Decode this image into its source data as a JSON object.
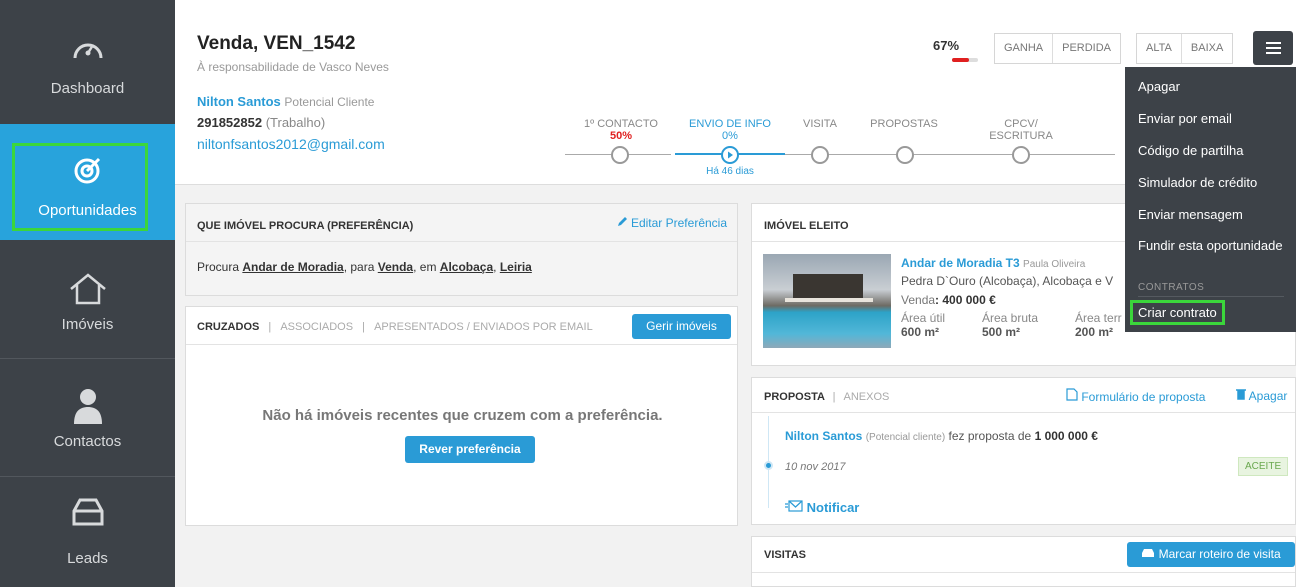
{
  "sidebar": {
    "items": [
      {
        "label": "Dashboard",
        "icon": "speedometer-icon"
      },
      {
        "label": "Oportunidades",
        "icon": "target-icon"
      },
      {
        "label": "Imóveis",
        "icon": "house-icon"
      },
      {
        "label": "Contactos",
        "icon": "person-icon"
      },
      {
        "label": "Leads",
        "icon": "inbox-icon"
      }
    ]
  },
  "header": {
    "title": "Venda, VEN_1542",
    "subtitle": "À responsabilidade de Vasco Neves",
    "client_name": "Nilton Santos",
    "client_status": "Potencial Cliente",
    "phone": "291852852",
    "phone_type": "(Trabalho)",
    "email": "niltonfsantos2012@gmail.com",
    "probability": "67%",
    "probability_value": 0.67,
    "btn_ganha": "GANHA",
    "btn_perdida": "PERDIDA",
    "btn_alta": "ALTA",
    "btn_baixa": "BAIXA"
  },
  "stages": [
    {
      "label": "1º CONTACTO",
      "pct": "50%"
    },
    {
      "label": "ENVIO DE INFO",
      "pct": "0%"
    },
    {
      "label": "VISITA",
      "pct": ""
    },
    {
      "label": "PROPOSTAS",
      "pct": ""
    },
    {
      "label": "CPCV/ ESCRITURA",
      "pct": ""
    }
  ],
  "stage_note": "Há 46 dias",
  "menu": {
    "items": [
      "Apagar",
      "Enviar por email",
      "Código de partilha",
      "Simulador de crédito",
      "Enviar mensagem",
      "Fundir esta oportunidade"
    ],
    "section": "CONTRATOS",
    "contract_item": "Criar contrato"
  },
  "preference": {
    "title": "QUE IMÓVEL PROCURA (PREFERÊNCIA)",
    "edit": "Editar Preferência",
    "text_1": "Procura ",
    "type": "Andar de Moradia",
    "text_2": ", para ",
    "deal": "Venda",
    "text_3": ", em ",
    "place1": "Alcobaça",
    "text_4": ", ",
    "place2": "Leiria"
  },
  "cross": {
    "tab_1": "CRUZADOS",
    "tab_2": "ASSOCIADOS",
    "tab_3": "APRESENTADOS / ENVIADOS POR EMAIL",
    "manage": "Gerir imóveis",
    "empty": "Não há imóveis recentes que cruzem com a preferência.",
    "review": "Rever preferência"
  },
  "elected": {
    "title": "IMÓVEL ELEITO",
    "name": "Andar de Moradia T3",
    "agent": "Paula Oliveira",
    "location": "Pedra D`Ouro (Alcobaça), Alcobaça e V",
    "price_label": "Venda",
    "price": ": 400 000 €",
    "area_util_label": "Área útil",
    "area_util": "600 m²",
    "area_bruta_label": "Área bruta",
    "area_bruta": "500 m²",
    "area_terr_label": "Área terr",
    "area_terr": "200 m²"
  },
  "proposal": {
    "tab_1": "PROPOSTA",
    "tab_2": "ANEXOS",
    "form": "Formulário de proposta",
    "delete": "Apagar",
    "who": "Nilton Santos",
    "who_status": "(Potencial cliente)",
    "text": " fez proposta de ",
    "amount": "1 000 000 €",
    "date": "10 nov 2017",
    "badge": "ACEITE",
    "notify": "Notificar"
  },
  "visits": {
    "title": "VISITAS",
    "schedule": "Marcar roteiro de visita"
  },
  "colors": {
    "accent": "#2a9bd6",
    "sidebar": "#3d4248",
    "highlight": "#3bd63b",
    "danger": "#e02020"
  }
}
